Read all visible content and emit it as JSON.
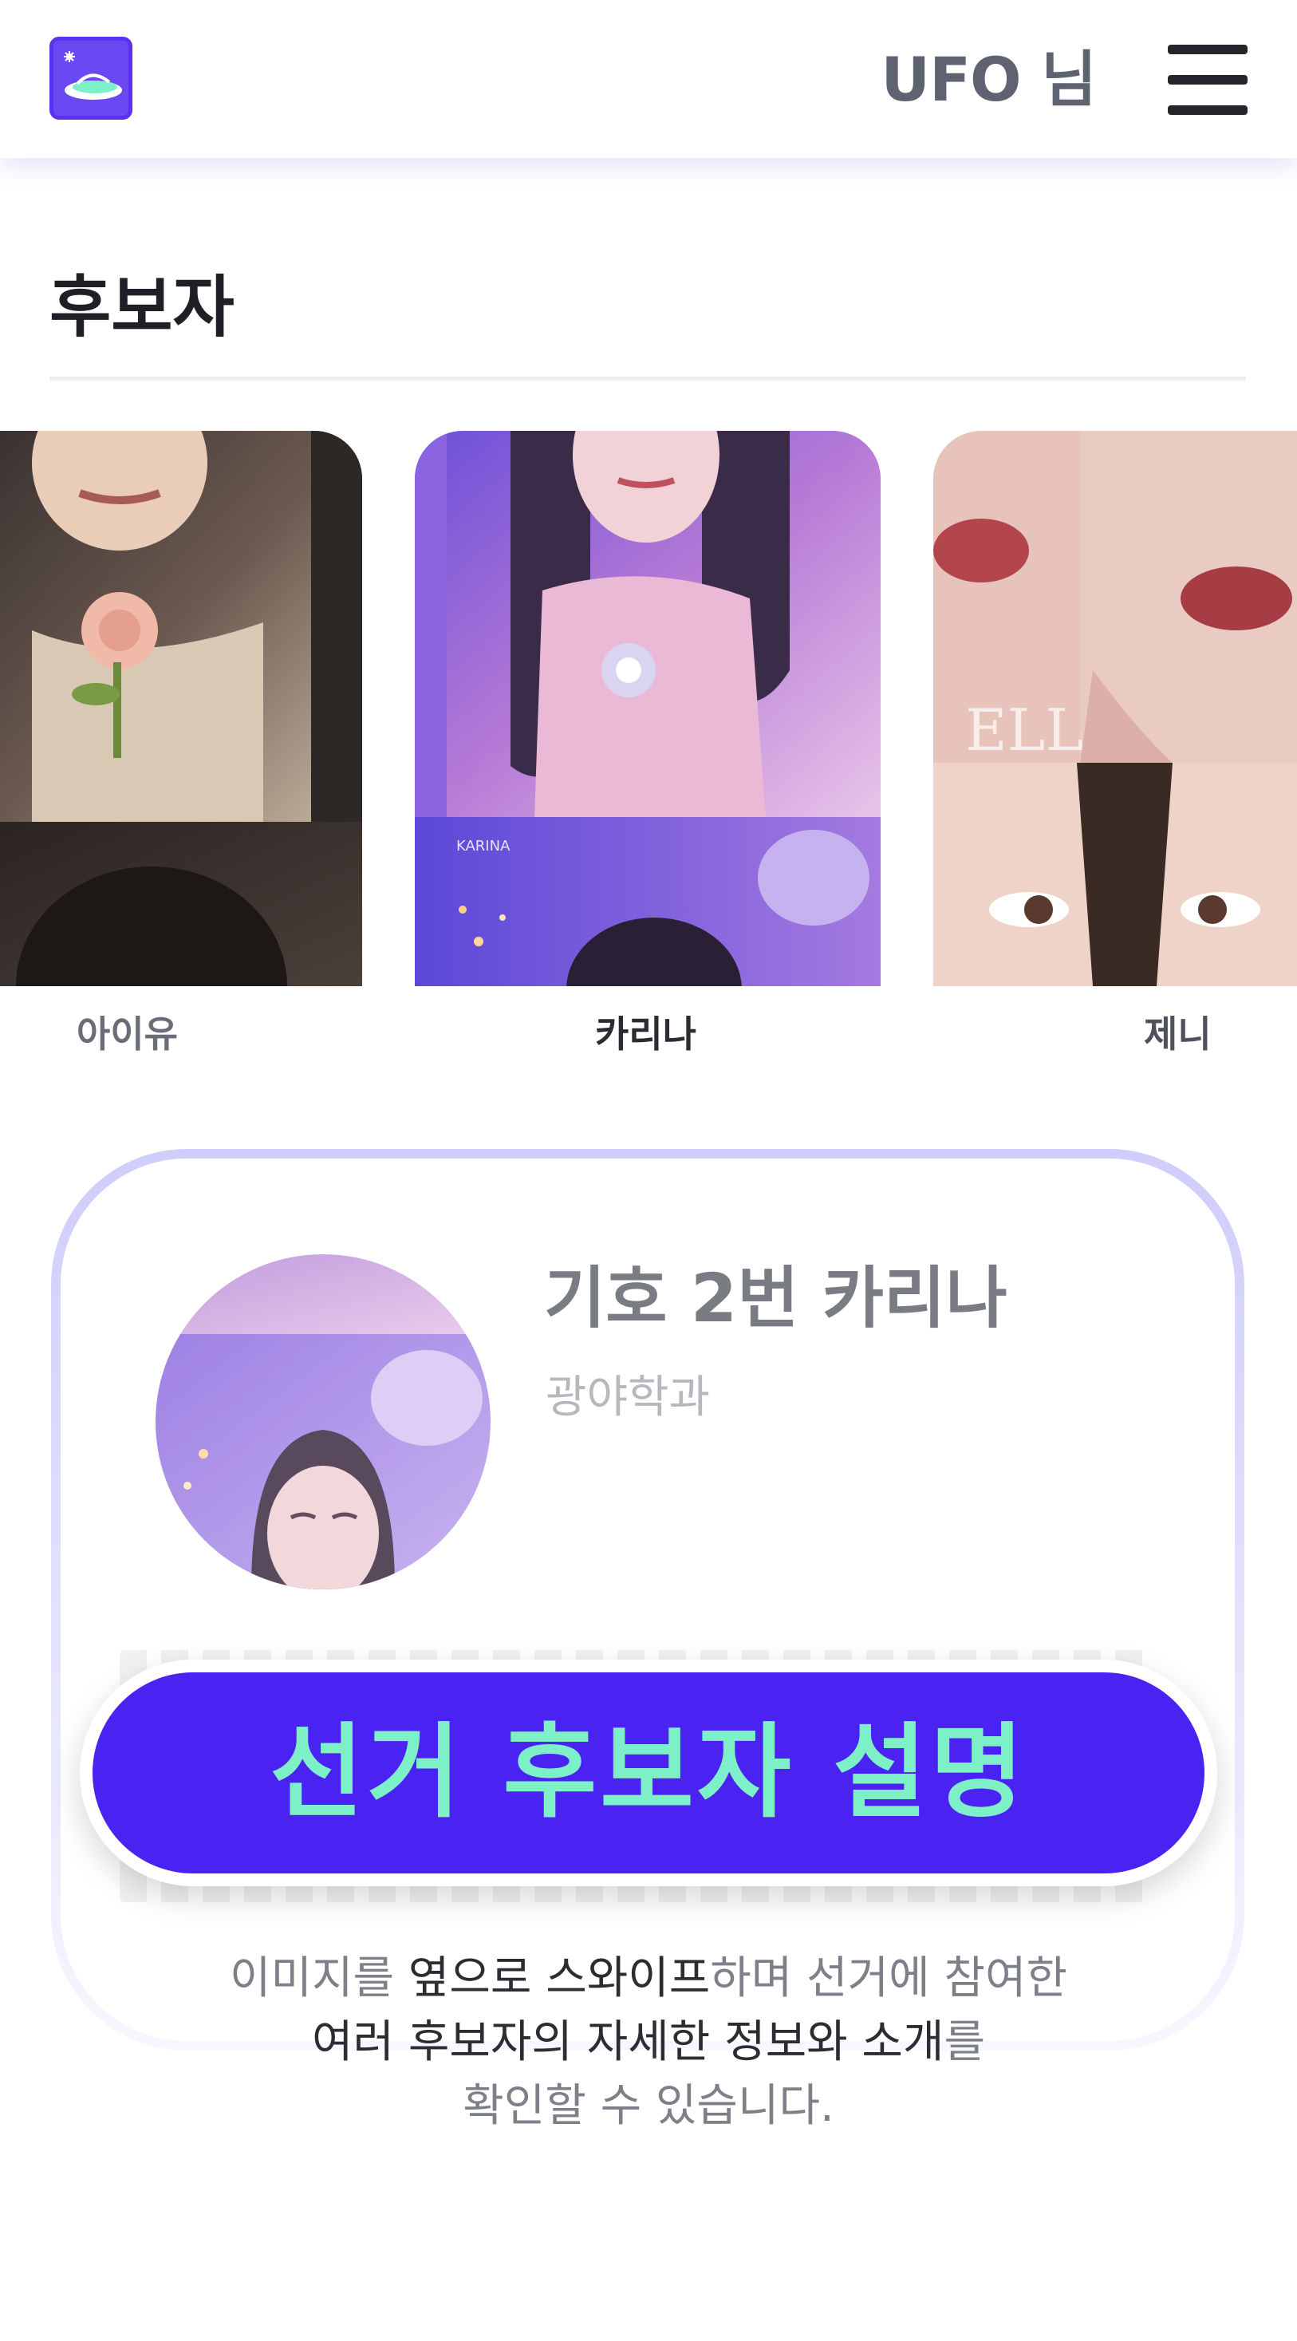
{
  "header": {
    "user_name": "UFO 님"
  },
  "section": {
    "title": "후보자"
  },
  "carousel": {
    "cards": [
      {
        "name": "아이유"
      },
      {
        "name": "카리나"
      },
      {
        "name": "제니"
      }
    ]
  },
  "detail": {
    "title": "기호 2번 카리나",
    "department": "광야학과"
  },
  "cta": {
    "label": "선거 후보자 설명"
  },
  "description": {
    "part1": "이미지를 ",
    "part2": "옆으로 스와이프",
    "part3": "하며 선거에 참여한",
    "part4": "여러 후보자의 자세한 정보와 소개",
    "part5": "를",
    "part6": "확인할 수 있습니다."
  },
  "colors": {
    "brand": "#4a23f2",
    "accent": "#7ef0c8",
    "panel_border": "#cfcdfa"
  }
}
